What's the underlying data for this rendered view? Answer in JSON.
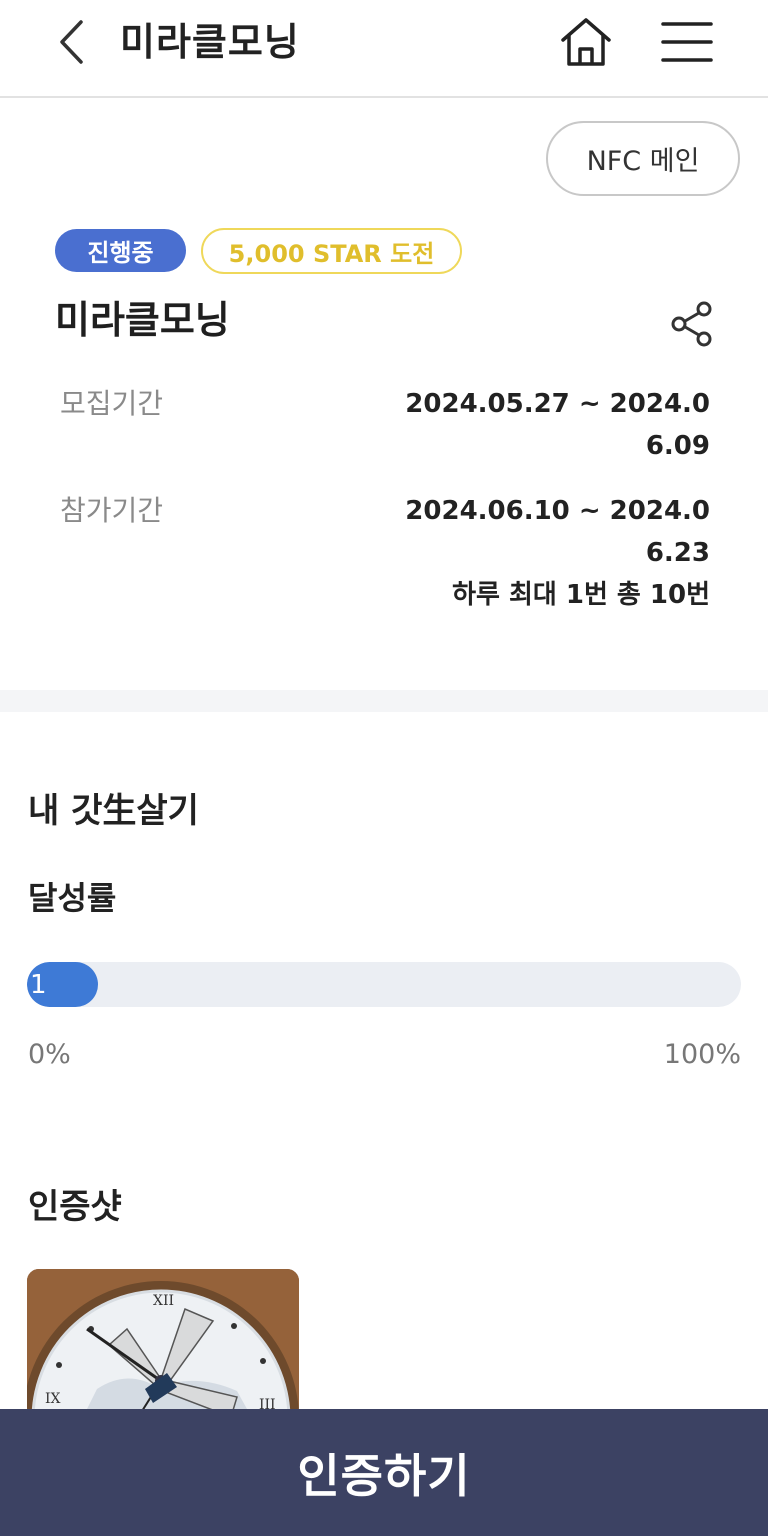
{
  "header": {
    "title": "미라클모닝",
    "back_icon": "chevron-left-icon",
    "home_icon": "home-icon",
    "menu_icon": "hamburger-menu-icon"
  },
  "nfc_button": {
    "label": "NFC 메인"
  },
  "challenge": {
    "status_badge": "진행중",
    "reward_badge": "5,000 STAR 도전",
    "title": "미라클모닝",
    "share_icon": "share-icon",
    "recruit": {
      "label": "모집기간",
      "value": "2024.05.27 ~ 2024.06.09"
    },
    "participate": {
      "label": "참가기간",
      "value": "2024.06.10 ~ 2024.06.23",
      "extra": "하루 최대 1번 총 10번"
    }
  },
  "stats": {
    "section_title": "내 갓生살기",
    "rate_title": "달성률",
    "progress_value": "1",
    "progress_fraction": 0.1,
    "min_label": "0%",
    "max_label": "100%"
  },
  "photos": {
    "title": "인증샷"
  },
  "cta": {
    "label": "인증하기"
  },
  "colors": {
    "status_badge": "#4a6fd0",
    "reward_badge_border": "#efd85a",
    "reward_badge_text": "#e0be2c",
    "progress_fill": "#3e7ad6",
    "progress_track": "#ebeef3",
    "cta_background": "#3c4263"
  }
}
